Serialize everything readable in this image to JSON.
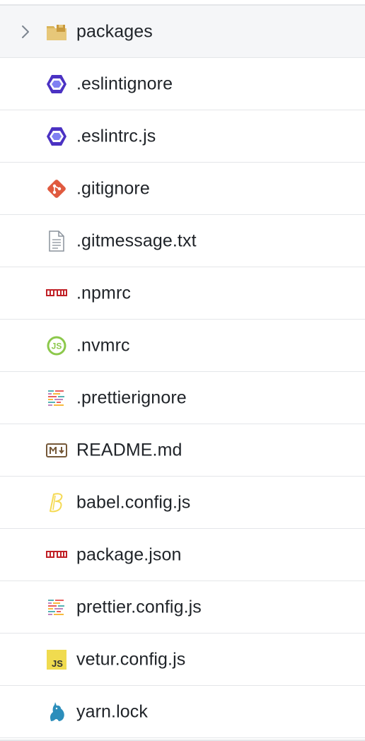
{
  "file_tree": {
    "folder": {
      "label": "packages",
      "icon": "package-folder-icon",
      "expanded": false
    },
    "files": [
      {
        "label": ".eslintignore",
        "icon": "eslint-icon"
      },
      {
        "label": ".eslintrc.js",
        "icon": "eslint-icon"
      },
      {
        "label": ".gitignore",
        "icon": "git-icon"
      },
      {
        "label": ".gitmessage.txt",
        "icon": "text-file-icon"
      },
      {
        "label": ".npmrc",
        "icon": "npm-icon"
      },
      {
        "label": ".nvmrc",
        "icon": "nodejs-icon"
      },
      {
        "label": ".prettierignore",
        "icon": "prettier-icon"
      },
      {
        "label": "README.md",
        "icon": "markdown-icon"
      },
      {
        "label": "babel.config.js",
        "icon": "babel-icon"
      },
      {
        "label": "package.json",
        "icon": "npm-icon"
      },
      {
        "label": "prettier.config.js",
        "icon": "prettier-icon"
      },
      {
        "label": "vetur.config.js",
        "icon": "javascript-icon"
      },
      {
        "label": "yarn.lock",
        "icon": "yarn-icon"
      }
    ]
  },
  "colors": {
    "eslint": "#4b32c3",
    "git": "#e05a3f",
    "npm": "#c12127",
    "nodejs": "#8cc84b",
    "babel": "#f5da55",
    "javascript": "#f0db4f",
    "yarn": "#2c8ebb",
    "folder": "#d9b45a"
  }
}
